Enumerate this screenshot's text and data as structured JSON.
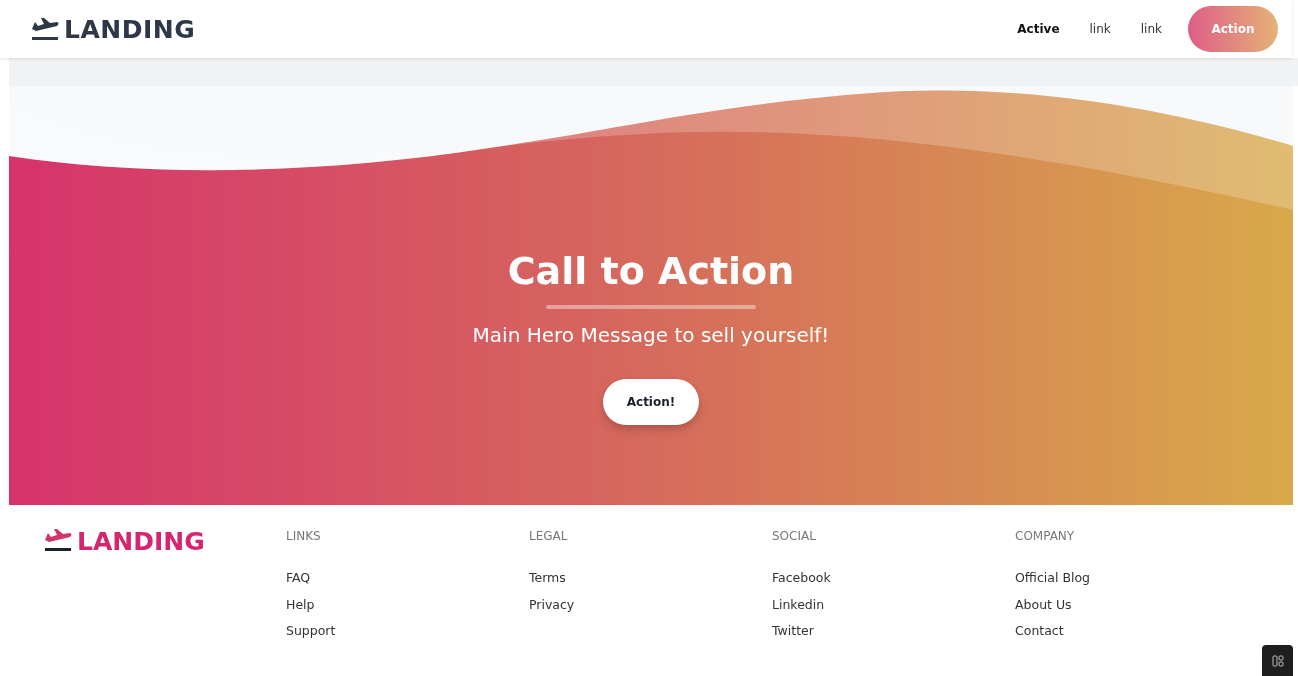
{
  "header": {
    "logo": "LANDING",
    "nav": [
      {
        "label": "Active",
        "selected": true
      },
      {
        "label": "link",
        "selected": false
      },
      {
        "label": "link",
        "selected": false
      }
    ],
    "action_button": "Action"
  },
  "hero": {
    "title": "Call to Action",
    "message": "Main Hero Message to sell yourself!",
    "button": "Action!"
  },
  "footer": {
    "logo": "LANDING",
    "columns": [
      {
        "heading": "LINKS",
        "links": [
          "FAQ",
          "Help",
          "Support"
        ]
      },
      {
        "heading": "LEGAL",
        "links": [
          "Terms",
          "Privacy"
        ]
      },
      {
        "heading": "SOCIAL",
        "links": [
          "Facebook",
          "Linkedin",
          "Twitter"
        ]
      },
      {
        "heading": "COMPANY",
        "links": [
          "Official Blog",
          "About Us",
          "Contact"
        ]
      }
    ]
  }
}
